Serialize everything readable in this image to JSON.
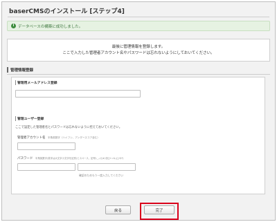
{
  "page": {
    "title": "baserCMSのインストール [ステップ4]"
  },
  "alert": {
    "icon": "info-icon",
    "message": "データベースの構築に成功しました。",
    "color": "#3c763d"
  },
  "notice": {
    "line1": "最後に管理情報を登録します。",
    "line2": "ここで入力した管理者アカウント名やパスワードは忘れないようにしておいてください。"
  },
  "section": {
    "title": "管理情報登録"
  },
  "email": {
    "title": "管理用メールアドレス登録",
    "value": ""
  },
  "admin": {
    "title": "管理ユーザー登録",
    "description": "ここで設定した管理者名とパスワードは忘れないように控えておいてください。",
    "account_label": "管理者アカウント名",
    "account_hint": "半角英数字（ハイフン、アンダースコア含む）",
    "account_value": "",
    "password_label": "パスワード",
    "password_hint": "半角英数字(英字は大文字小文字を区別)とスペース、記号(._-:/()#,@[]+=&;{}!$*)",
    "password_value": "",
    "password_confirm_value": "",
    "password_confirm_hint": "確認のためもう一度入力してください"
  },
  "buttons": {
    "back_label": "戻る",
    "finish_label": "完了"
  },
  "colors": {
    "highlight": "#d9001b",
    "success_bg": "#e6f2e2"
  }
}
